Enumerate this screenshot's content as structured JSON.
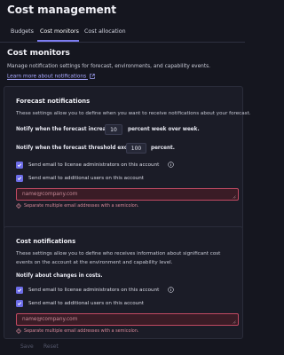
{
  "page": {
    "title": "Cost management"
  },
  "tabs": [
    {
      "label": "Budgets",
      "active": false
    },
    {
      "label": "Cost monitors",
      "active": true
    },
    {
      "label": "Cost allocation",
      "active": false
    }
  ],
  "section": {
    "heading": "Cost monitors",
    "description": "Manage notification settings for forecast, environments, and capability events.",
    "learn_more": "Learn more about notifications"
  },
  "forecast": {
    "title": "Forecast notifications",
    "description": "These settings allow you to define when you want to receive notifications about your forecast.",
    "increase_label": "Notify when the forecast increases",
    "increase_value": "10",
    "increase_suffix": "percent week over week.",
    "threshold_label": "Notify when the forecast threshold exceeds",
    "threshold_value": "100",
    "threshold_suffix": "percent.",
    "check_admins": "Send email to license administrators on this account",
    "check_additional": "Send email to additional users on this account",
    "email_placeholder": "name@company.com",
    "email_hint": "Separate multiple email addresses with a semicolon."
  },
  "cost": {
    "title": "Cost notifications",
    "description": "These settings allow you to define who receives information about significant cost events on the account at the environment and capability level.",
    "changes_label": "Notify about changes in costs.",
    "check_admins": "Send email to license administrators on this account",
    "check_additional": "Send email to additional users on this account",
    "email_placeholder": "name@company.com",
    "email_hint": "Separate multiple email addresses with a semicolon."
  },
  "footer": {
    "save": "Save",
    "reset": "Reset"
  },
  "colors": {
    "accent": "#7c7cf0",
    "error": "#c24a63",
    "background": "#15161f"
  }
}
